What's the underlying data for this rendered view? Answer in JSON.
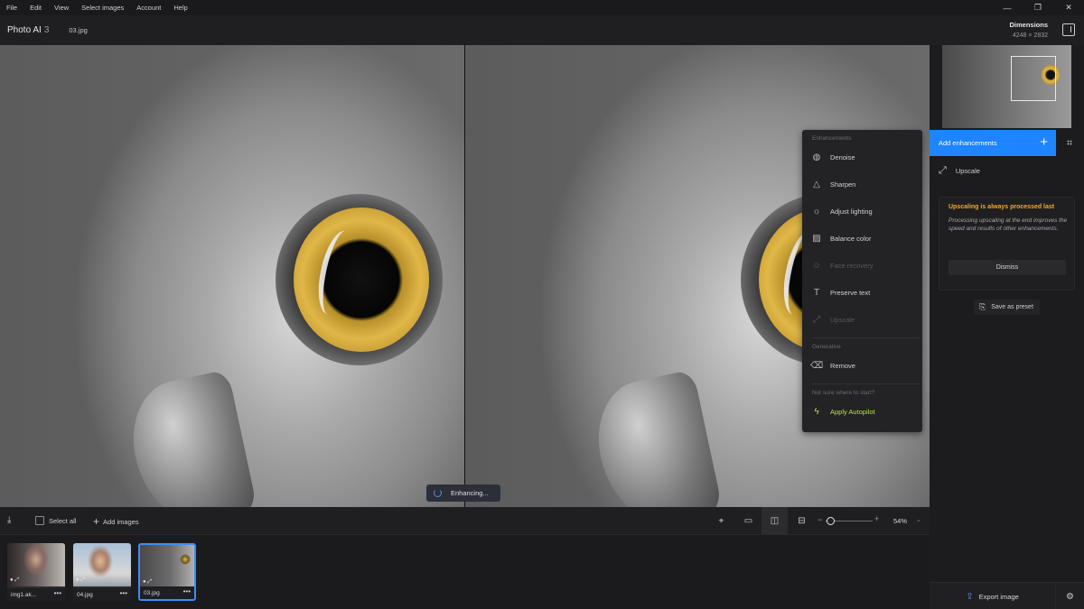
{
  "menubar": {
    "items": [
      "File",
      "Edit",
      "View",
      "Select images",
      "Account",
      "Help"
    ],
    "window_controls": [
      "minimize-icon",
      "restore-icon",
      "close-icon"
    ]
  },
  "header": {
    "app_name": "Photo AI",
    "app_version": "3",
    "file_name": "03.jpg",
    "dimensions_label": "Dimensions",
    "dimensions_value": "4248 × 2832"
  },
  "canvas": {
    "status": "Enhancing..."
  },
  "dropdown": {
    "section_enhancements": "Enhancements",
    "items": [
      {
        "label": "Denoise",
        "icon": "globe-icon",
        "disabled": false
      },
      {
        "label": "Sharpen",
        "icon": "triangle-icon",
        "disabled": false
      },
      {
        "label": "Adjust lighting",
        "icon": "sun-icon",
        "disabled": false
      },
      {
        "label": "Balance color",
        "icon": "image-icon",
        "disabled": false
      },
      {
        "label": "Face recovery",
        "icon": "face-icon",
        "disabled": true
      },
      {
        "label": "Preserve text",
        "icon": "text-icon",
        "disabled": false
      },
      {
        "label": "Upscale",
        "icon": "expand-icon",
        "disabled": true
      }
    ],
    "section_generative": "Generative",
    "generative_items": [
      {
        "label": "Remove",
        "icon": "eraser-icon"
      }
    ],
    "section_help": "Not sure where to start?",
    "autopilot": {
      "label": "Apply Autopilot",
      "icon": "bolt-icon",
      "color": "#b6e04a"
    }
  },
  "rpanel": {
    "add_enhancements": "Add enhancements",
    "accent": "#1e84ff",
    "upscale": "Upscale",
    "notice_title": "Upscaling is always processed last",
    "notice_body": "Processing upscaling at the end improves the speed and results of other enhancements.",
    "dismiss": "Dismiss",
    "save_preset": "Save as preset",
    "export": "Export image"
  },
  "toolbar": {
    "select_all": "Select all",
    "add_images": "Add images",
    "zoom": "54%"
  },
  "filmstrip": {
    "items": [
      {
        "name": "img1.ak...",
        "selected": false
      },
      {
        "name": "04.jpg",
        "selected": false
      },
      {
        "name": "03.jpg",
        "selected": true
      }
    ]
  }
}
